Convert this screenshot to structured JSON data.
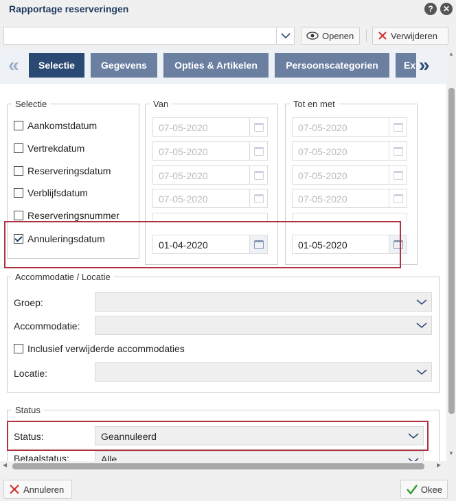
{
  "window": {
    "title": "Rapportage reserveringen"
  },
  "toolbar": {
    "open_label": "Openen",
    "delete_label": "Verwijderen"
  },
  "tabs": [
    {
      "label": "Selectie",
      "active": true
    },
    {
      "label": "Gegevens"
    },
    {
      "label": "Opties & Artikelen"
    },
    {
      "label": "Persoonscategorien"
    },
    {
      "label": "Ex"
    }
  ],
  "selectie": {
    "legend": "Selectie",
    "items": [
      {
        "label": "Aankomstdatum",
        "checked": false
      },
      {
        "label": "Vertrekdatum",
        "checked": false
      },
      {
        "label": "Reserveringsdatum",
        "checked": false
      },
      {
        "label": "Verblijfsdatum",
        "checked": false
      },
      {
        "label": "Reserveringsnummer",
        "checked": false
      },
      {
        "label": "Annuleringsdatum",
        "checked": true
      }
    ]
  },
  "van": {
    "legend": "Van",
    "dates": [
      "07-05-2020",
      "07-05-2020",
      "07-05-2020",
      "07-05-2020",
      "",
      "01-04-2020"
    ]
  },
  "totenmet": {
    "legend": "Tot en met",
    "dates": [
      "07-05-2020",
      "07-05-2020",
      "07-05-2020",
      "07-05-2020",
      "",
      "01-05-2020"
    ]
  },
  "accommodatie": {
    "legend": "Accommodatie / Locatie",
    "groep_label": "Groep:",
    "accommodatie_label": "Accommodatie:",
    "inclusief_label": "Inclusief verwijderde accommodaties",
    "locatie_label": "Locatie:"
  },
  "status": {
    "legend": "Status",
    "status_label": "Status:",
    "status_value": "Geannuleerd",
    "betaal_label": "Betaalstatus:",
    "betaal_value": "Alle"
  },
  "footer": {
    "cancel_label": "Annuleren",
    "ok_label": "Okee"
  },
  "colors": {
    "tab_active": "#2b4a73",
    "tab": "#6b7fa1",
    "highlight": "#b03040",
    "ok_check": "#2e9a2e",
    "cancel_x": "#d23030"
  }
}
